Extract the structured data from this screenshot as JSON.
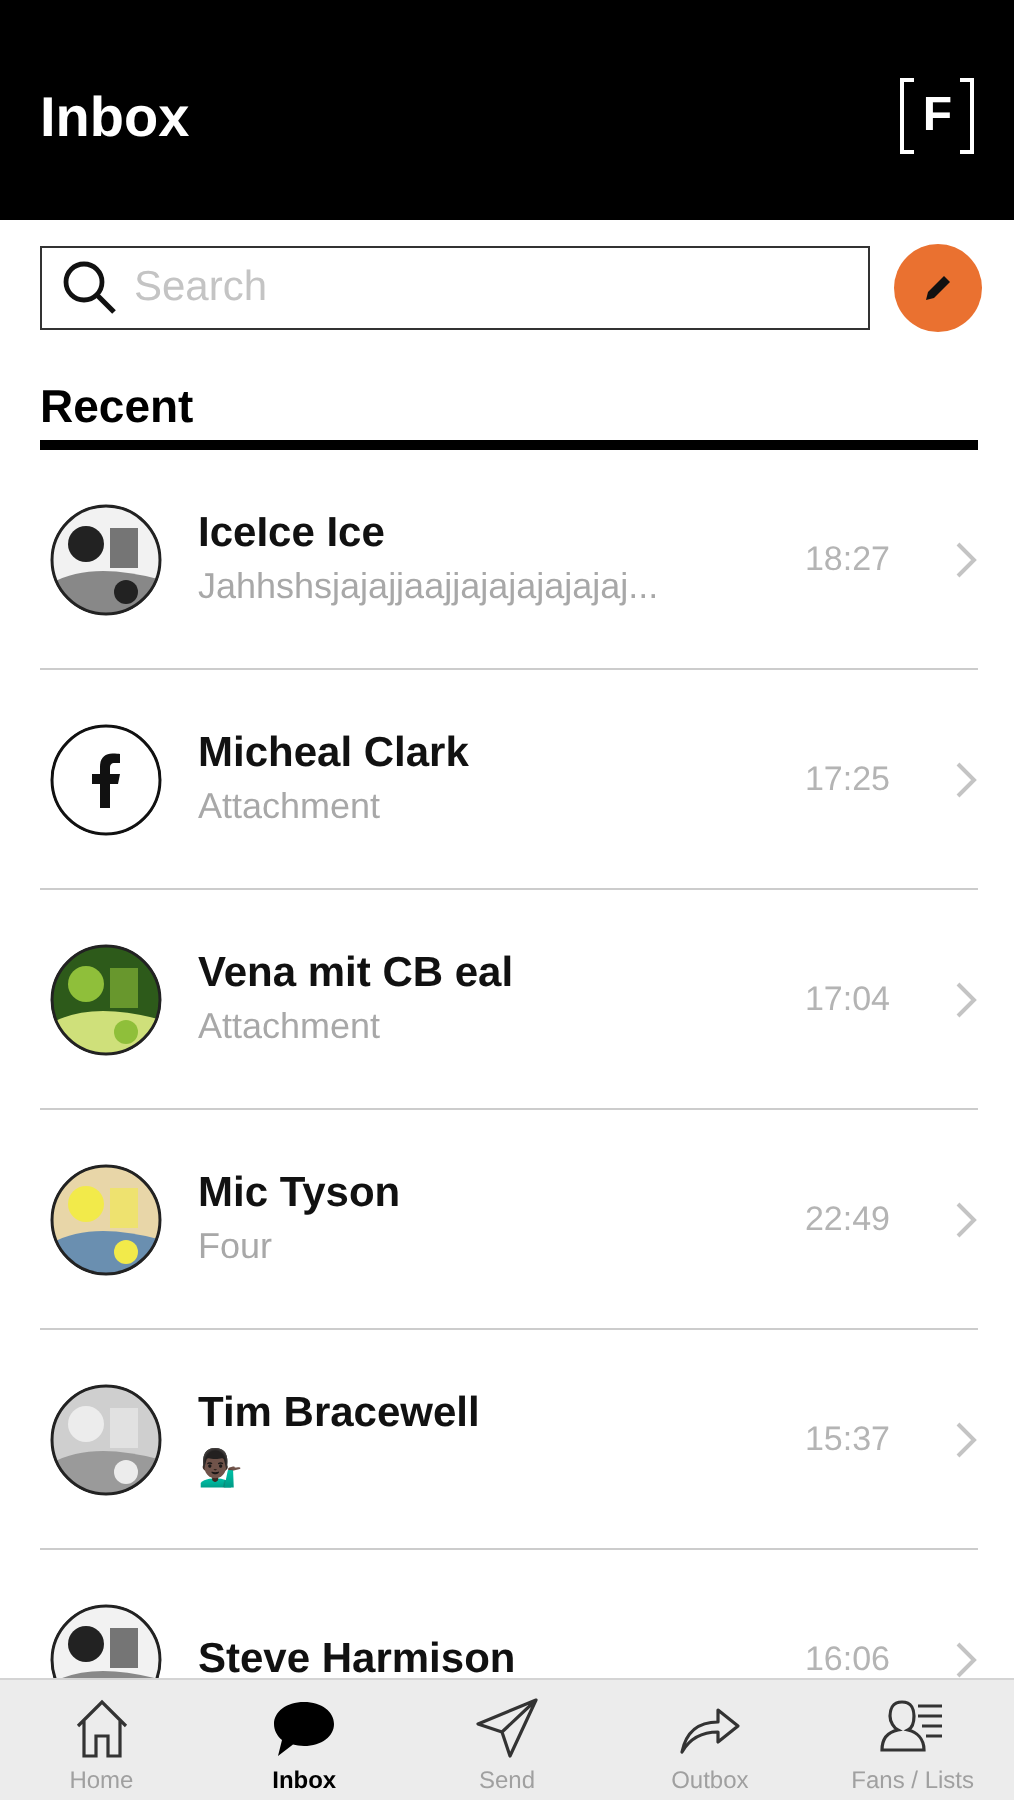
{
  "header": {
    "title": "Inbox",
    "logo": "F"
  },
  "search": {
    "placeholder": "Search"
  },
  "section": {
    "title": "Recent"
  },
  "conversations": [
    {
      "name": "IceIce Ice",
      "preview": "Jahhshsjajajjaajjajajajajajaj...",
      "time": "18:27"
    },
    {
      "name": "Micheal Clark",
      "preview": "Attachment",
      "time": "17:25",
      "avatar": {
        "kind": "facebook"
      }
    },
    {
      "name": "Vena mit CB eal",
      "preview": "Attachment",
      "time": "17:04"
    },
    {
      "name": "Mic Tyson",
      "preview": "Four",
      "time": "22:49"
    },
    {
      "name": "Tim Bracewell",
      "preview": "💁🏿‍♂️",
      "time": "15:37"
    },
    {
      "name": "Steve Harmison",
      "time": "16:06"
    }
  ],
  "tab_bar": [
    {
      "label": "Home",
      "kind": "home",
      "selected": false
    },
    {
      "label": "Inbox",
      "kind": "inbox",
      "selected": true
    },
    {
      "label": "Send",
      "kind": "send",
      "selected": false
    },
    {
      "label": "Outbox",
      "kind": "outbox",
      "selected": false
    },
    {
      "label": "Fans / Lists",
      "kind": "fans",
      "selected": false
    }
  ]
}
